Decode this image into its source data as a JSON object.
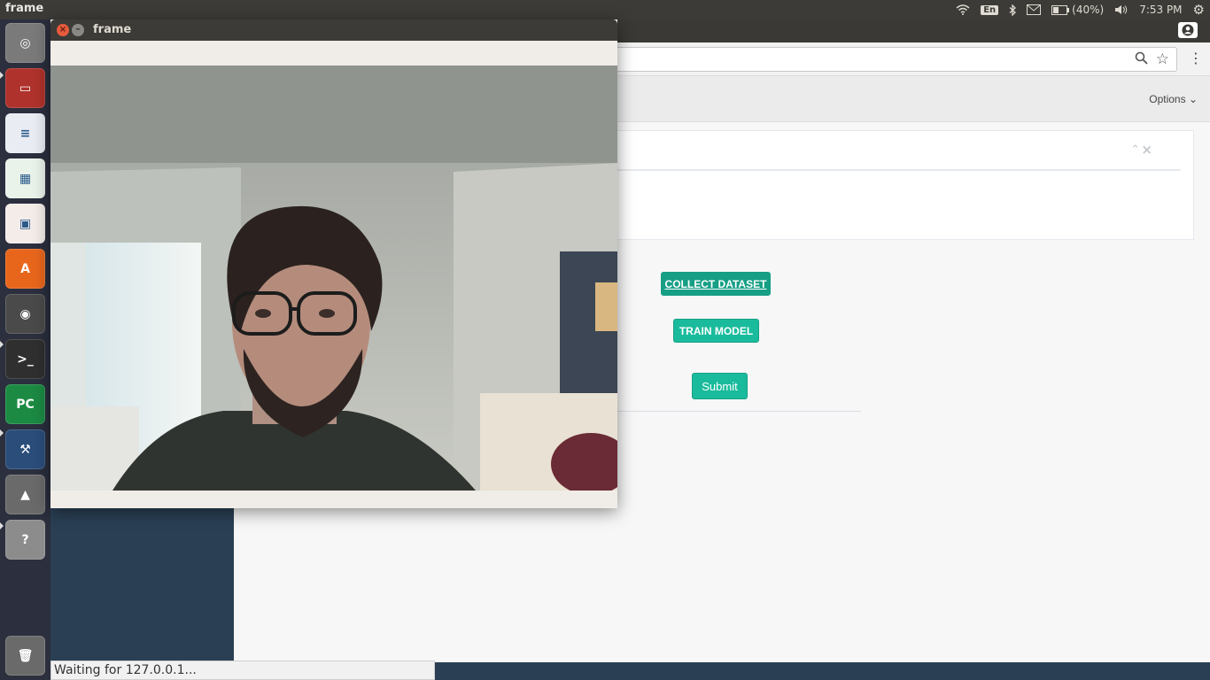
{
  "top_panel": {
    "title": "frame",
    "lang": "En",
    "battery": "(40%)",
    "time": "7:53 PM"
  },
  "launcher": {
    "items": [
      {
        "name": "ubuntu-dash",
        "glyph": "◎",
        "color": "#7a7a7a"
      },
      {
        "name": "files",
        "glyph": "▭",
        "color": "#b0322c"
      },
      {
        "name": "writer",
        "glyph": "≡",
        "color": "#e9edf3"
      },
      {
        "name": "calc",
        "glyph": "▦",
        "color": "#e9f3ea"
      },
      {
        "name": "impress",
        "glyph": "▣",
        "color": "#f3ece9"
      },
      {
        "name": "software-center",
        "glyph": "A",
        "color": "#e8661c"
      },
      {
        "name": "chrome",
        "glyph": "◉",
        "color": "#4a4a4a"
      },
      {
        "name": "terminal",
        "glyph": ">_",
        "color": "#2f2f2f"
      },
      {
        "name": "pycharm",
        "glyph": "PC",
        "color": "#1c8a43"
      },
      {
        "name": "mysql-workbench",
        "glyph": "⚒",
        "color": "#2a4d7a"
      },
      {
        "name": "vlc",
        "glyph": "▲",
        "color": "#6a6a6a"
      },
      {
        "name": "unknown-app",
        "glyph": "?",
        "color": "#8c8c8c"
      },
      {
        "name": "trash",
        "glyph": "🗑",
        "color": "#6a6a6a"
      }
    ]
  },
  "browser": {
    "options_label": "Options",
    "status_text": "Waiting for 127.0.0.1..."
  },
  "app": {
    "collect_label": "COLLECT DATASET",
    "train_label": "TRAIN MODEL",
    "submit_label": "Submit"
  },
  "frame_window": {
    "title": "frame"
  },
  "colors": {
    "accent": "#1abb9c",
    "sidebar": "#2a3f54",
    "panel_bg": "#3c3b37"
  }
}
